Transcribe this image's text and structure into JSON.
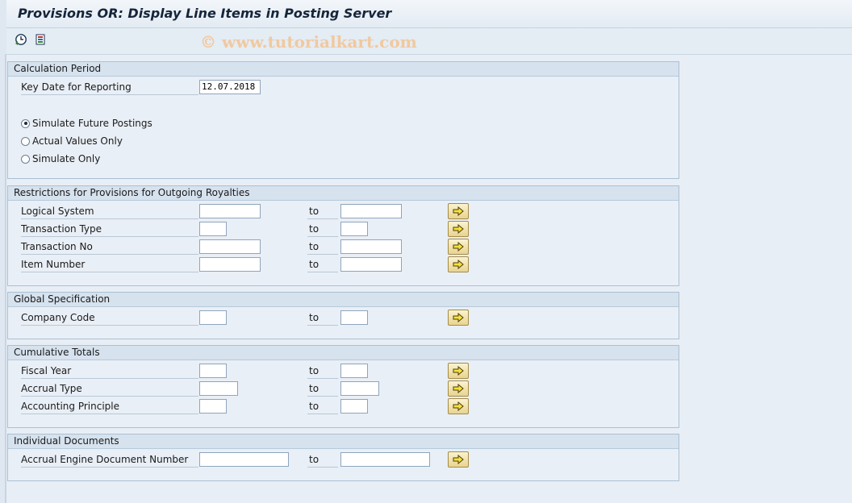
{
  "title": "Provisions OR: Display Line Items in Posting Server",
  "toolbar": {
    "execute_icon": "execute-clock-icon",
    "selection_icon": "selection-options-icon"
  },
  "watermark": "© www.tutorialkart.com",
  "calc_period": {
    "header": "Calculation Period",
    "key_date_label": "Key Date for Reporting",
    "key_date_value": "12.07.2018",
    "radio1": "Simulate Future Postings",
    "radio2": "Actual Values Only",
    "radio3": "Simulate Only",
    "selected": "Simulate Future Postings"
  },
  "restrictions": {
    "header": "Restrictions for Provisions for Outgoing Royalties",
    "rows": [
      {
        "label": "Logical System",
        "to": "to"
      },
      {
        "label": "Transaction Type",
        "to": "to"
      },
      {
        "label": "Transaction No",
        "to": "to"
      },
      {
        "label": "Item Number",
        "to": "to"
      }
    ]
  },
  "global_spec": {
    "header": "Global Specification",
    "rows": [
      {
        "label": "Company Code",
        "to": "to"
      }
    ]
  },
  "cumulative": {
    "header": "Cumulative Totals",
    "rows": [
      {
        "label": "Fiscal Year",
        "to": "to"
      },
      {
        "label": "Accrual Type",
        "to": "to"
      },
      {
        "label": "Accounting Principle",
        "to": "to"
      }
    ]
  },
  "individual": {
    "header": "Individual Documents",
    "rows": [
      {
        "label": "Accrual Engine Document Number",
        "to": "to"
      }
    ]
  },
  "colors": {
    "arrow_button": "#e9d490",
    "group_border": "#aac0d4"
  }
}
